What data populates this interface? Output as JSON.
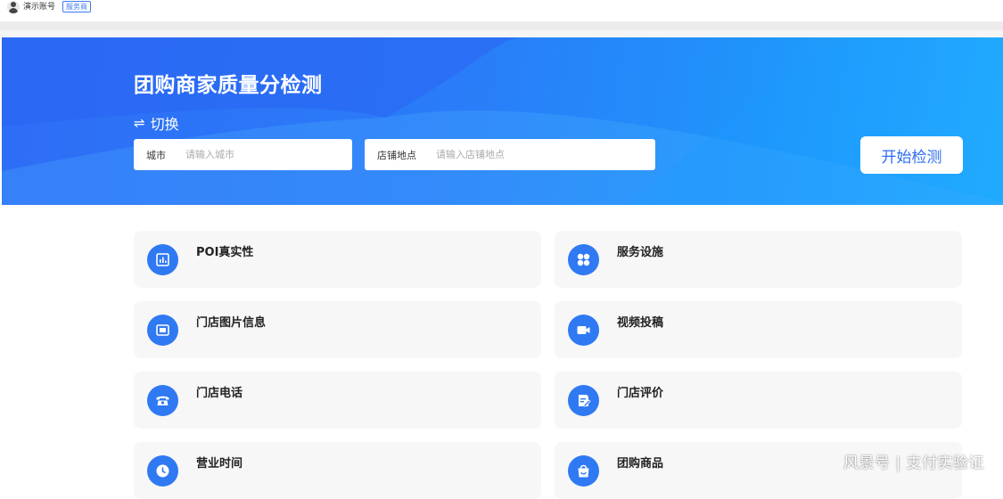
{
  "account": {
    "name": "演示账号",
    "badge": "服务商"
  },
  "hero": {
    "title": "团购商家质量分检测",
    "switch_label": "切换",
    "city": {
      "label": "城市",
      "placeholder": "请输入城市"
    },
    "store": {
      "label": "店铺地点",
      "placeholder": "请输入店铺地点"
    },
    "start_button": "开始检测"
  },
  "checks": [
    {
      "title": "POI真实性",
      "icon": "bar-chart-icon"
    },
    {
      "title": "服务设施",
      "icon": "grid-icon"
    },
    {
      "title": "门店图片信息",
      "icon": "image-icon"
    },
    {
      "title": "视频投稿",
      "icon": "video-camera-icon"
    },
    {
      "title": "门店电话",
      "icon": "telephone-icon"
    },
    {
      "title": "门店评价",
      "icon": "review-edit-icon"
    },
    {
      "title": "营业时间",
      "icon": "clock-icon"
    },
    {
      "title": "团购商品",
      "icon": "shopping-bag-icon"
    }
  ],
  "watermark": "风景号 | 支付实验证",
  "colors": {
    "accent": "#2f79f3",
    "hero_start": "#2e6df6",
    "hero_end": "#23b4ff",
    "card_bg": "#f7f7f8"
  }
}
